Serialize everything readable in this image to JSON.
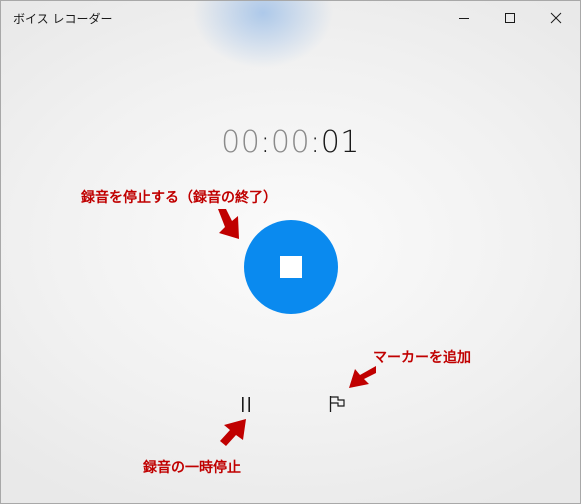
{
  "window": {
    "title": "ボイス レコーダー"
  },
  "timer": {
    "hours": "00",
    "sep1": ":",
    "minutes": "00",
    "sep2": ":",
    "seconds": "01"
  },
  "annotations": {
    "stop": "録音を停止する（録音の終了）",
    "marker": "マーカーを追加",
    "pause": "録音の一時停止"
  },
  "colors": {
    "accent": "#0a8aef",
    "annotation": "#c00000"
  },
  "icons": {
    "minimize": "minimize-icon",
    "maximize": "maximize-icon",
    "close": "close-icon",
    "stop": "stop-icon",
    "pause": "pause-icon",
    "flag": "flag-icon"
  }
}
